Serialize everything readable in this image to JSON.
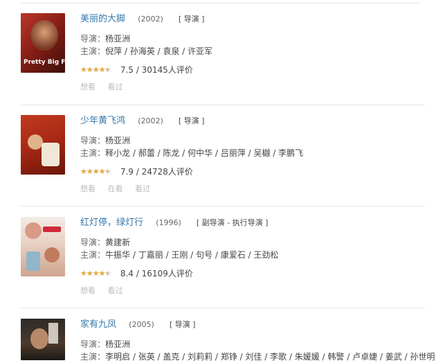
{
  "colors": {
    "link": "#3377aa",
    "star": "#e6a83a",
    "divider": "#e6e6e6"
  },
  "labels": {
    "director": "导演：",
    "cast": "主演：",
    "rating_suffix": "人评价"
  },
  "items": [
    {
      "title": "美丽的大脚",
      "year": "(2002)",
      "role": "[ 导演 ]",
      "director": "杨亚洲",
      "cast": "倪萍 / 孙海英 / 袁泉 / 许亚军",
      "score": "7.5",
      "votes": "30145",
      "star_fraction": 0.8,
      "poster_text": "Pretty Big Feet",
      "poster_icon": "poster-image",
      "actions": [
        "想看",
        "看过"
      ]
    },
    {
      "title": "少年黄飞鸿",
      "year": "(2002)",
      "role": "[ 导演 ]",
      "director": "杨亚洲",
      "cast": "释小龙 / 郝蕾 / 陈龙 / 何中华 / 吕丽萍 / 吴樾 / 李鹏飞",
      "score": "7.9",
      "votes": "24728",
      "star_fraction": 0.8,
      "poster_text": "",
      "poster_icon": "poster-image",
      "actions": [
        "想看",
        "在看",
        "看过"
      ]
    },
    {
      "title": "红灯停，绿灯行",
      "year": "(1996)",
      "role": "[ 副导演 - 执行导演 ]",
      "director": "黄建新",
      "cast": "牛振华 / 丁嘉丽 / 王刚 / 句号 / 康爱石 / 王劲松",
      "score": "8.4",
      "votes": "16109",
      "star_fraction": 0.8,
      "poster_text": "",
      "poster_icon": "poster-image",
      "actions": [
        "想看",
        "看过"
      ]
    },
    {
      "title": "家有九凤",
      "year": "(2005)",
      "role": "[ 导演 ]",
      "director": "杨亚洲",
      "cast": "李明启 / 张英 / 盖克 / 刘莉莉 / 郑铮 / 刘佳 / 李歌 / 朱媛媛 / 韩警 / 卢卓婕 / 姜武 / 孙世明",
      "score": "",
      "votes": "",
      "star_fraction": 0,
      "poster_text": "",
      "poster_icon": "poster-image",
      "actions": []
    }
  ]
}
